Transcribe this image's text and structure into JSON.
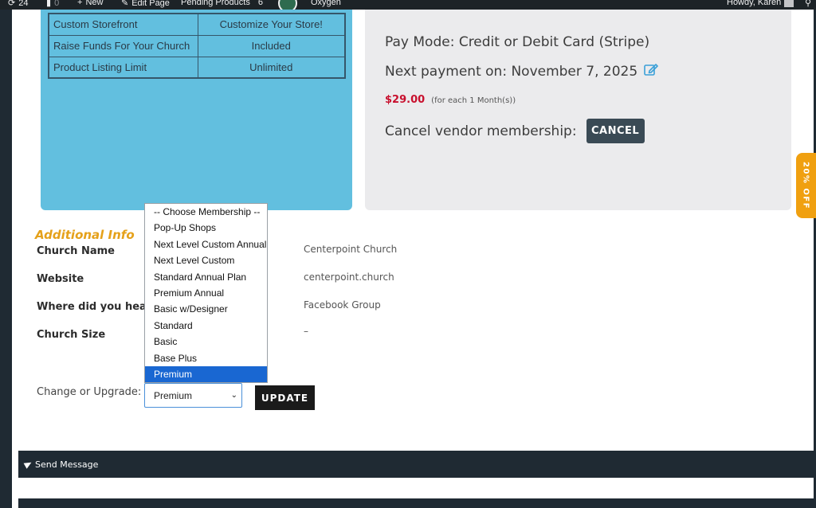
{
  "adminbar": {
    "updates_count": "24",
    "comments_count": "0",
    "new_label": "New",
    "edit_page_label": "Edit Page",
    "pending_products_label": "Pending Products",
    "pending_products_count": "6",
    "site_builder_label": "Oxygen",
    "greeting": "Howdy, Karen"
  },
  "plan_features": [
    {
      "feature": "Custom Storefront",
      "value": "Customize Your Store!"
    },
    {
      "feature": "Raise Funds For Your Church",
      "value": "Included"
    },
    {
      "feature": "Product Listing Limit",
      "value": "Unlimited"
    }
  ],
  "payment": {
    "pay_mode": "Pay Mode: Credit or Debit Card (Stripe)",
    "next_payment": "Next payment on: November 7, 2025",
    "price": "$29.00",
    "price_note": "(for each 1 Month(s))",
    "cancel_label": "Cancel vendor membership:",
    "cancel_button": "CANCEL"
  },
  "promo": {
    "label": "20% OFF"
  },
  "additional_info": {
    "title": "Additional Info",
    "fields": [
      {
        "label": "Church Name",
        "value": "Centerpoint Church"
      },
      {
        "label": "Website",
        "value": "centerpoint.church"
      },
      {
        "label": "Where did you hear a",
        "value": "Facebook Group"
      },
      {
        "label": "Church Size",
        "value": "–"
      }
    ]
  },
  "membership": {
    "change_label": "Change or Upgrade:",
    "selected": "Premium",
    "update_button": "UPDATE",
    "options": [
      "-- Choose Membership --",
      "Pop-Up Shops",
      "Next Level Custom Annual",
      "Next Level Custom",
      "Standard Annual Plan",
      "Premium Annual",
      "Basic w/Designer",
      "Standard",
      "Basic",
      "Base Plus",
      "Premium"
    ]
  },
  "send_message": {
    "label": "Send Message"
  },
  "colors": {
    "plan_card_bg": "#62bfdf",
    "price_red": "#c8102e",
    "accent_orange": "#e5a11a",
    "dark_bar": "#1f2a33"
  }
}
